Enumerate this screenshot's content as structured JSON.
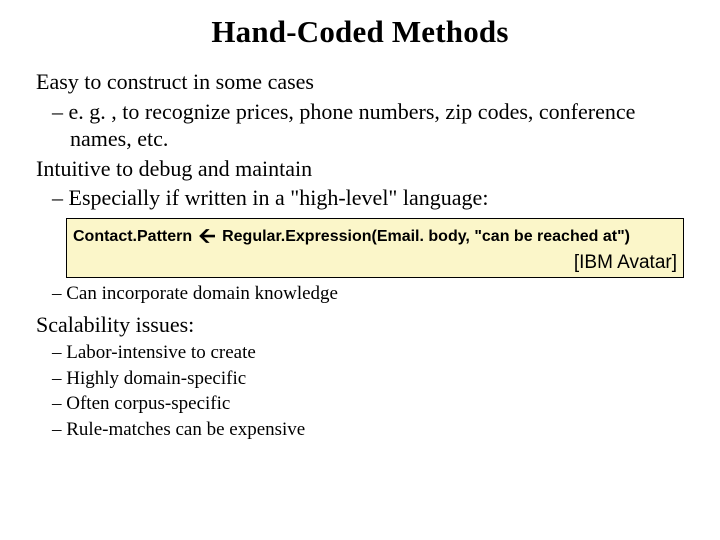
{
  "title": "Hand-Coded Methods",
  "points": {
    "p1": "Easy to construct in some cases",
    "p1a": "e. g. , to recognize prices, phone numbers, zip codes, conference names, etc.",
    "p2": "Intuitive to debug and maintain",
    "p2a": "Especially if written in a \"high-level\" language:",
    "code_lhs": "Contact.Pattern",
    "code_rhs": "Regular.Expression(Email. body, \"can be reached at\")",
    "attribution": "[IBM Avatar]",
    "p2b": "Can incorporate domain knowledge",
    "p3": "Scalability issues:",
    "p3a": "Labor-intensive to create",
    "p3b": "Highly domain-specific",
    "p3c": "Often corpus-specific",
    "p3d": "Rule-matches can be expensive"
  }
}
